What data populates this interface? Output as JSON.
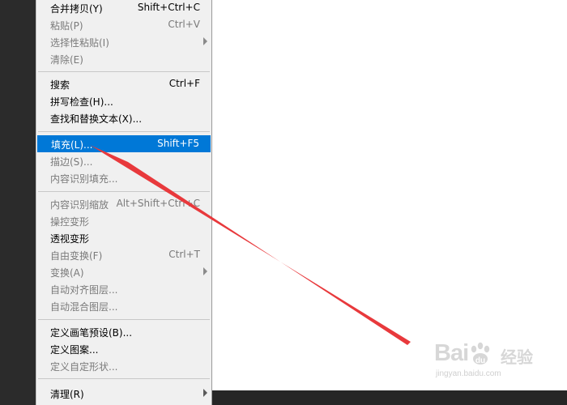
{
  "menu": {
    "items": [
      {
        "label": "合并拷贝(Y)",
        "shortcut": "Shift+Ctrl+C",
        "enabled": true,
        "highlighted": false,
        "submenu": false
      },
      {
        "label": "粘贴(P)",
        "shortcut": "Ctrl+V",
        "enabled": false,
        "highlighted": false,
        "submenu": false
      },
      {
        "label": "选择性粘贴(I)",
        "shortcut": "",
        "enabled": false,
        "highlighted": false,
        "submenu": true
      },
      {
        "label": "清除(E)",
        "shortcut": "",
        "enabled": false,
        "highlighted": false,
        "submenu": false
      },
      {
        "label": "搜索",
        "shortcut": "Ctrl+F",
        "enabled": true,
        "highlighted": false,
        "submenu": false
      },
      {
        "label": "拼写检查(H)...",
        "shortcut": "",
        "enabled": true,
        "highlighted": false,
        "submenu": false
      },
      {
        "label": "查找和替换文本(X)...",
        "shortcut": "",
        "enabled": true,
        "highlighted": false,
        "submenu": false
      },
      {
        "label": "填充(L)...",
        "shortcut": "Shift+F5",
        "enabled": true,
        "highlighted": true,
        "submenu": false
      },
      {
        "label": "描边(S)...",
        "shortcut": "",
        "enabled": false,
        "highlighted": false,
        "submenu": false
      },
      {
        "label": "内容识别填充...",
        "shortcut": "",
        "enabled": false,
        "highlighted": false,
        "submenu": false
      },
      {
        "label": "内容识别缩放",
        "shortcut": "Alt+Shift+Ctrl+C",
        "enabled": false,
        "highlighted": false,
        "submenu": false
      },
      {
        "label": "操控变形",
        "shortcut": "",
        "enabled": false,
        "highlighted": false,
        "submenu": false
      },
      {
        "label": "透视变形",
        "shortcut": "",
        "enabled": true,
        "highlighted": false,
        "submenu": false
      },
      {
        "label": "自由变换(F)",
        "shortcut": "Ctrl+T",
        "enabled": false,
        "highlighted": false,
        "submenu": false
      },
      {
        "label": "变换(A)",
        "shortcut": "",
        "enabled": false,
        "highlighted": false,
        "submenu": true
      },
      {
        "label": "自动对齐图层...",
        "shortcut": "",
        "enabled": false,
        "highlighted": false,
        "submenu": false
      },
      {
        "label": "自动混合图层...",
        "shortcut": "",
        "enabled": false,
        "highlighted": false,
        "submenu": false
      },
      {
        "label": "定义画笔预设(B)...",
        "shortcut": "",
        "enabled": true,
        "highlighted": false,
        "submenu": false
      },
      {
        "label": "定义图案...",
        "shortcut": "",
        "enabled": true,
        "highlighted": false,
        "submenu": false
      },
      {
        "label": "定义自定形状...",
        "shortcut": "",
        "enabled": false,
        "highlighted": false,
        "submenu": false
      },
      {
        "label": "清理(R)",
        "shortcut": "",
        "enabled": true,
        "highlighted": false,
        "submenu": true
      }
    ]
  },
  "annotation": {
    "arrow_color": "#e8393c"
  },
  "watermark": {
    "logo": "Bai",
    "brand": "经验",
    "url": "jingyan.baidu.com"
  },
  "colors": {
    "highlight": "#0078d7",
    "menu_bg": "#f0f0f0",
    "workspace": "#282828",
    "canvas": "#ffffff"
  }
}
